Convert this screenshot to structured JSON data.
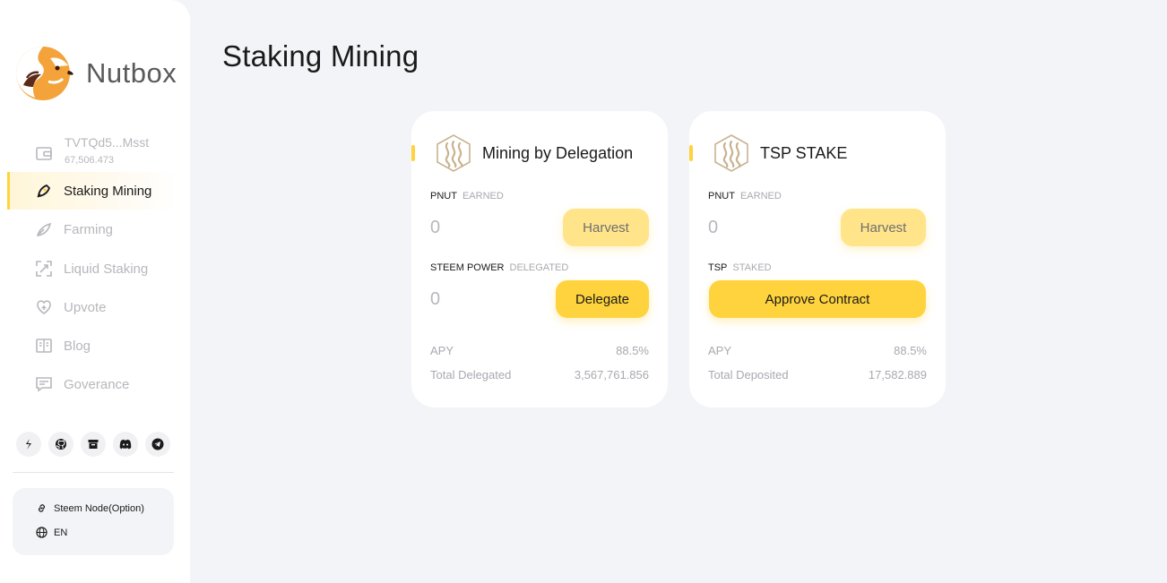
{
  "brand": {
    "name": "Nutbox"
  },
  "wallet": {
    "address": "TVTQd5...Msst",
    "balance": "67,506.473"
  },
  "nav": [
    {
      "key": "staking",
      "label": "Staking Mining",
      "icon": "staking-icon",
      "active": true
    },
    {
      "key": "farming",
      "label": "Farming",
      "icon": "farming-icon"
    },
    {
      "key": "liquid",
      "label": "Liquid Staking",
      "icon": "liquid-staking-icon"
    },
    {
      "key": "upvote",
      "label": "Upvote",
      "icon": "upvote-icon"
    },
    {
      "key": "blog",
      "label": "Blog",
      "icon": "blog-icon"
    },
    {
      "key": "gov",
      "label": "Goverance",
      "icon": "governance-icon"
    }
  ],
  "socials": [
    "steem-icon",
    "github-icon",
    "archive-icon",
    "discord-icon",
    "telegram-icon"
  ],
  "settings": {
    "node_label": "Steem Node(Option)",
    "language": "EN"
  },
  "page": {
    "title": "Staking Mining"
  },
  "cards": [
    {
      "title": "Mining by Delegation",
      "earned_token": "PNUT",
      "earned_label": "EARNED",
      "earned_value": "0",
      "harvest_label": "Harvest",
      "stake_token": "STEEM POWER",
      "stake_label": "DELEGATED",
      "stake_value": "0",
      "action_label": "Delegate",
      "apy_label": "APY",
      "apy_value": "88.5%",
      "total_label": "Total Delegated",
      "total_value": "3,567,761.856"
    },
    {
      "title": "TSP STAKE",
      "earned_token": "PNUT",
      "earned_label": "EARNED",
      "earned_value": "0",
      "harvest_label": "Harvest",
      "stake_token": "TSP",
      "stake_label": "STAKED",
      "action_label": "Approve Contract",
      "apy_label": "APY",
      "apy_value": "88.5%",
      "total_label": "Total Deposited",
      "total_value": "17,582.889"
    }
  ],
  "colors": {
    "accent": "#ffd33d",
    "accent_faded": "#ffe48a",
    "background": "#f3f4f7",
    "muted_text": "#b7b7bd"
  }
}
